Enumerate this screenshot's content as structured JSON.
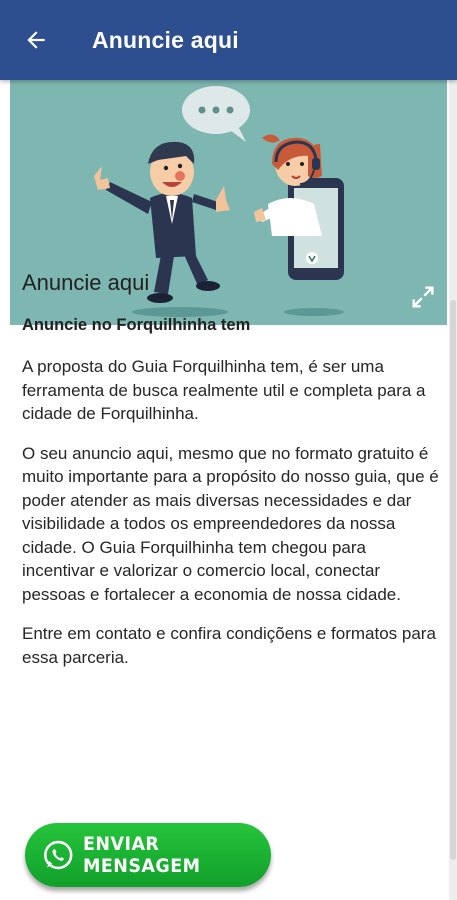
{
  "appbar": {
    "title": "Anuncie aqui",
    "color": "#2d4f8f",
    "back_icon": "arrow-left-icon"
  },
  "hero": {
    "background": "#7eb7b1",
    "expand_icon": "expand-icon"
  },
  "content": {
    "title": "Anuncie aqui",
    "subtitle": "Anuncie no Forquilhinha tem",
    "paragraphs": [
      "A proposta do Guia Forquilhinha tem, é ser uma ferramenta de busca realmente util e completa para a cidade de Forquilhinha.",
      "O seu anuncio aqui, mesmo que no formato gratuito é muito importante para a propósito do nosso guia, que é poder atender as mais diversas necessidades e dar visibilidade a todos os empreendedores da nossa cidade.  O Guia Forquilhinha tem chegou para incentivar e valorizar o comercio local, conectar pessoas e fortalecer a economia de nossa cidade.",
      "Entre em contato e confira condiçõens e formatos para essa parceria."
    ]
  },
  "whatsapp_button": {
    "label": "ENVIAR MENSAGEM",
    "icon": "whatsapp-icon",
    "color": "#1db532"
  }
}
